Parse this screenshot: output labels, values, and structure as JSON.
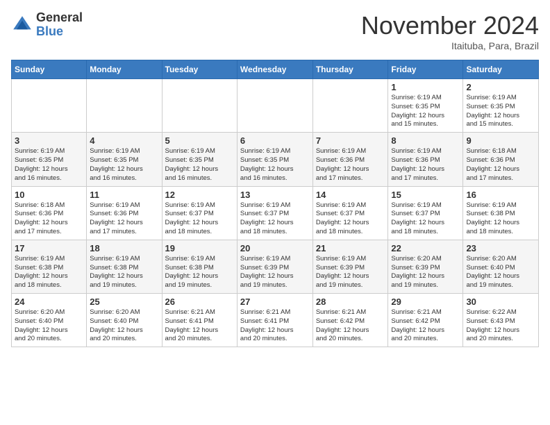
{
  "header": {
    "logo_general": "General",
    "logo_blue": "Blue",
    "month_title": "November 2024",
    "location": "Itaituba, Para, Brazil"
  },
  "days_of_week": [
    "Sunday",
    "Monday",
    "Tuesday",
    "Wednesday",
    "Thursday",
    "Friday",
    "Saturday"
  ],
  "weeks": [
    [
      {
        "day": "",
        "info": ""
      },
      {
        "day": "",
        "info": ""
      },
      {
        "day": "",
        "info": ""
      },
      {
        "day": "",
        "info": ""
      },
      {
        "day": "",
        "info": ""
      },
      {
        "day": "1",
        "info": "Sunrise: 6:19 AM\nSunset: 6:35 PM\nDaylight: 12 hours\nand 15 minutes."
      },
      {
        "day": "2",
        "info": "Sunrise: 6:19 AM\nSunset: 6:35 PM\nDaylight: 12 hours\nand 15 minutes."
      }
    ],
    [
      {
        "day": "3",
        "info": "Sunrise: 6:19 AM\nSunset: 6:35 PM\nDaylight: 12 hours\nand 16 minutes."
      },
      {
        "day": "4",
        "info": "Sunrise: 6:19 AM\nSunset: 6:35 PM\nDaylight: 12 hours\nand 16 minutes."
      },
      {
        "day": "5",
        "info": "Sunrise: 6:19 AM\nSunset: 6:35 PM\nDaylight: 12 hours\nand 16 minutes."
      },
      {
        "day": "6",
        "info": "Sunrise: 6:19 AM\nSunset: 6:35 PM\nDaylight: 12 hours\nand 16 minutes."
      },
      {
        "day": "7",
        "info": "Sunrise: 6:19 AM\nSunset: 6:36 PM\nDaylight: 12 hours\nand 17 minutes."
      },
      {
        "day": "8",
        "info": "Sunrise: 6:19 AM\nSunset: 6:36 PM\nDaylight: 12 hours\nand 17 minutes."
      },
      {
        "day": "9",
        "info": "Sunrise: 6:18 AM\nSunset: 6:36 PM\nDaylight: 12 hours\nand 17 minutes."
      }
    ],
    [
      {
        "day": "10",
        "info": "Sunrise: 6:18 AM\nSunset: 6:36 PM\nDaylight: 12 hours\nand 17 minutes."
      },
      {
        "day": "11",
        "info": "Sunrise: 6:19 AM\nSunset: 6:36 PM\nDaylight: 12 hours\nand 17 minutes."
      },
      {
        "day": "12",
        "info": "Sunrise: 6:19 AM\nSunset: 6:37 PM\nDaylight: 12 hours\nand 18 minutes."
      },
      {
        "day": "13",
        "info": "Sunrise: 6:19 AM\nSunset: 6:37 PM\nDaylight: 12 hours\nand 18 minutes."
      },
      {
        "day": "14",
        "info": "Sunrise: 6:19 AM\nSunset: 6:37 PM\nDaylight: 12 hours\nand 18 minutes."
      },
      {
        "day": "15",
        "info": "Sunrise: 6:19 AM\nSunset: 6:37 PM\nDaylight: 12 hours\nand 18 minutes."
      },
      {
        "day": "16",
        "info": "Sunrise: 6:19 AM\nSunset: 6:38 PM\nDaylight: 12 hours\nand 18 minutes."
      }
    ],
    [
      {
        "day": "17",
        "info": "Sunrise: 6:19 AM\nSunset: 6:38 PM\nDaylight: 12 hours\nand 18 minutes."
      },
      {
        "day": "18",
        "info": "Sunrise: 6:19 AM\nSunset: 6:38 PM\nDaylight: 12 hours\nand 19 minutes."
      },
      {
        "day": "19",
        "info": "Sunrise: 6:19 AM\nSunset: 6:38 PM\nDaylight: 12 hours\nand 19 minutes."
      },
      {
        "day": "20",
        "info": "Sunrise: 6:19 AM\nSunset: 6:39 PM\nDaylight: 12 hours\nand 19 minutes."
      },
      {
        "day": "21",
        "info": "Sunrise: 6:19 AM\nSunset: 6:39 PM\nDaylight: 12 hours\nand 19 minutes."
      },
      {
        "day": "22",
        "info": "Sunrise: 6:20 AM\nSunset: 6:39 PM\nDaylight: 12 hours\nand 19 minutes."
      },
      {
        "day": "23",
        "info": "Sunrise: 6:20 AM\nSunset: 6:40 PM\nDaylight: 12 hours\nand 19 minutes."
      }
    ],
    [
      {
        "day": "24",
        "info": "Sunrise: 6:20 AM\nSunset: 6:40 PM\nDaylight: 12 hours\nand 20 minutes."
      },
      {
        "day": "25",
        "info": "Sunrise: 6:20 AM\nSunset: 6:40 PM\nDaylight: 12 hours\nand 20 minutes."
      },
      {
        "day": "26",
        "info": "Sunrise: 6:21 AM\nSunset: 6:41 PM\nDaylight: 12 hours\nand 20 minutes."
      },
      {
        "day": "27",
        "info": "Sunrise: 6:21 AM\nSunset: 6:41 PM\nDaylight: 12 hours\nand 20 minutes."
      },
      {
        "day": "28",
        "info": "Sunrise: 6:21 AM\nSunset: 6:42 PM\nDaylight: 12 hours\nand 20 minutes."
      },
      {
        "day": "29",
        "info": "Sunrise: 6:21 AM\nSunset: 6:42 PM\nDaylight: 12 hours\nand 20 minutes."
      },
      {
        "day": "30",
        "info": "Sunrise: 6:22 AM\nSunset: 6:43 PM\nDaylight: 12 hours\nand 20 minutes."
      }
    ]
  ]
}
